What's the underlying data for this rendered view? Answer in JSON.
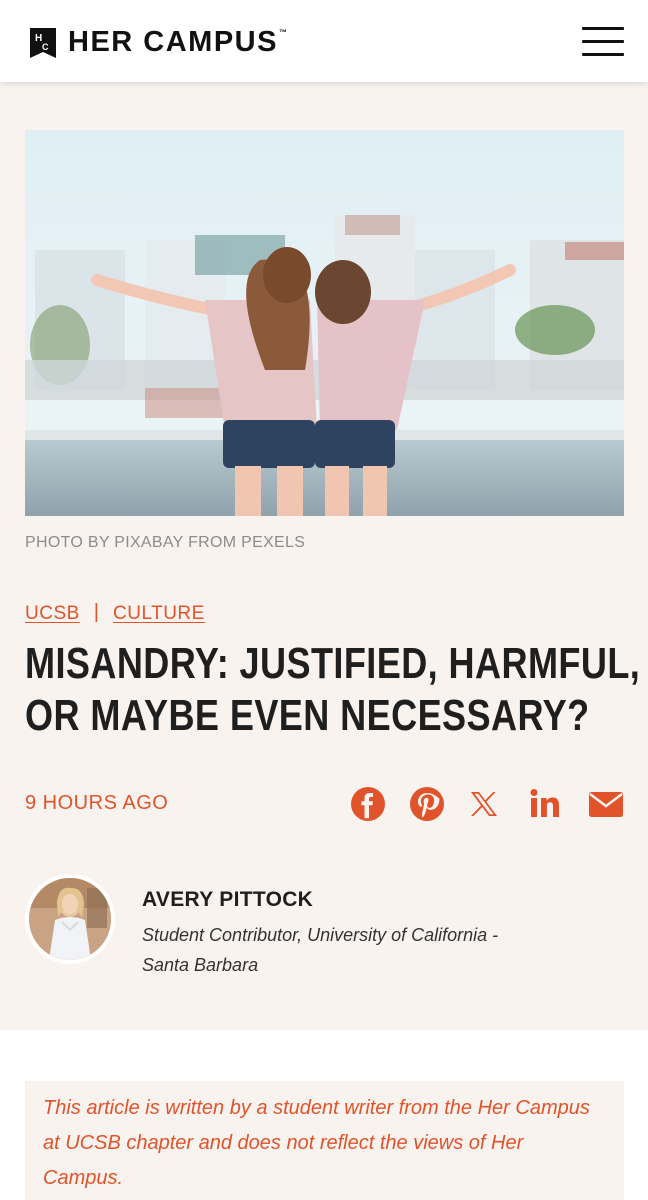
{
  "header": {
    "brand": "HER CAMPUS",
    "tm": "™",
    "logo_mark": "H C",
    "menu_icon": "hamburger-menu-icon"
  },
  "hero": {
    "image_description_icon": "photo",
    "caption": "PHOTO BY PIXABAY FROM PEXELS"
  },
  "article": {
    "tags": [
      "UCSB",
      "CULTURE"
    ],
    "title_line1": "MISANDRY: JUSTIFIED, HARMFUL,",
    "title_line2": "OR MAYBE EVEN NECESSARY?",
    "published": "9 HOURS AGO"
  },
  "share": {
    "icons": [
      "facebook-icon",
      "pinterest-icon",
      "x-icon",
      "linkedin-icon",
      "email-icon"
    ],
    "color": "#e1532a"
  },
  "author": {
    "name": "AVERY PITTOCK",
    "role_line1": "Student Contributor, University of California -",
    "role_line2": "Santa Barbara"
  },
  "disclaimer": {
    "text": "This article is written by a student writer from the Her Campus at UCSB chapter and does not reflect the views of Her Campus."
  },
  "colors": {
    "accent": "#e1532a",
    "background_tint": "#f8f3ef",
    "title": "#1f1f1f"
  }
}
